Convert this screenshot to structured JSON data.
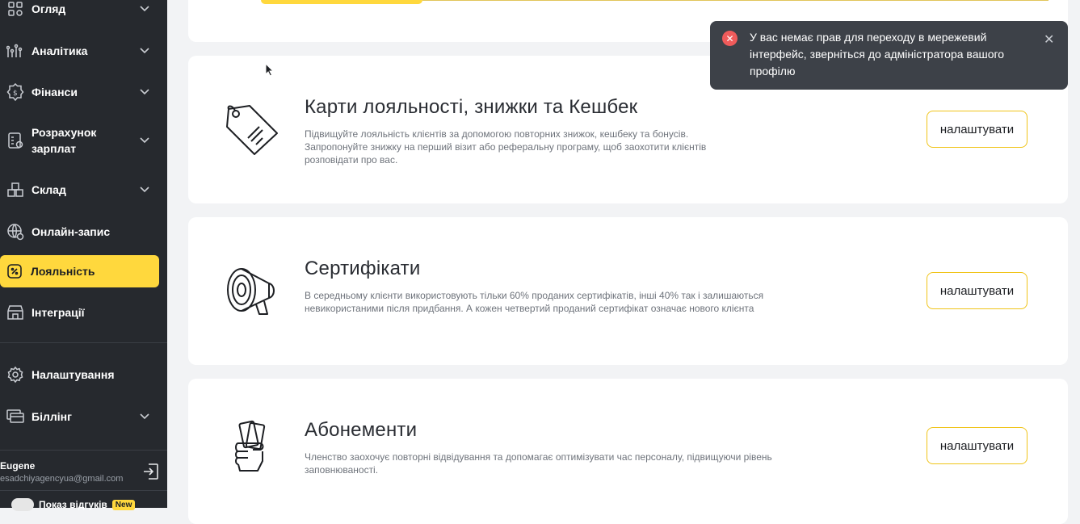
{
  "sidebar": {
    "items": [
      {
        "label": "Огляд",
        "icon": "grid-icon"
      },
      {
        "label": "Аналітика",
        "icon": "analytics-icon"
      },
      {
        "label": "Фінанси",
        "icon": "finance-icon"
      },
      {
        "label": "Розрахунок зарплат",
        "icon": "payroll-icon"
      },
      {
        "label": "Склад",
        "icon": "warehouse-icon"
      },
      {
        "label": "Онлайн-запис",
        "icon": "online-booking-icon"
      },
      {
        "label": "Лояльність",
        "icon": "loyalty-icon"
      },
      {
        "label": "Інтеграції",
        "icon": "integrations-icon"
      },
      {
        "label": "Налаштування",
        "icon": "gear-icon"
      },
      {
        "label": "Біллінг",
        "icon": "billing-icon"
      }
    ],
    "payroll_line1": "Розрахунок",
    "payroll_line2": "зарплат",
    "user": {
      "name": "Eugene",
      "email": "esadchiyagencyua@gmail.com"
    },
    "bottom": {
      "label": "Показ відгуків",
      "badge": "New"
    }
  },
  "cards": [
    {
      "title": "Карти лояльності, знижки та Кешбек",
      "description": "Підвищуйте лояльність клієнтів за допомогою повторних знижок, кешбеку та бонусів. Запропонуйте знижку на перший візит або реферальну програму, щоб заохотити клієнтів розповідати про вас.",
      "button": "налаштувати"
    },
    {
      "title": "Сертифікати",
      "description": "В середньому клієнти використовують тільки 60% проданих сертифікатів, інші 40% так і залишаються невикористаними після придбання. А кожен четвертий проданий сертифікат означає нового клієнта",
      "button": "налаштувати"
    },
    {
      "title": "Абонементи",
      "description": "Членство заохочує повторні відвідування та допомагає оптимізувати час персоналу, підвищуючи рівень заповнюваності.",
      "button": "налаштувати"
    }
  ],
  "toast": {
    "message": "У вас немає прав для переходу в мережевий інтерфейс, зверніться до адміністратора вашого профілю"
  },
  "colors": {
    "accent": "#ffd83d",
    "sidebar": "#26292e",
    "error": "#f05b5b"
  }
}
